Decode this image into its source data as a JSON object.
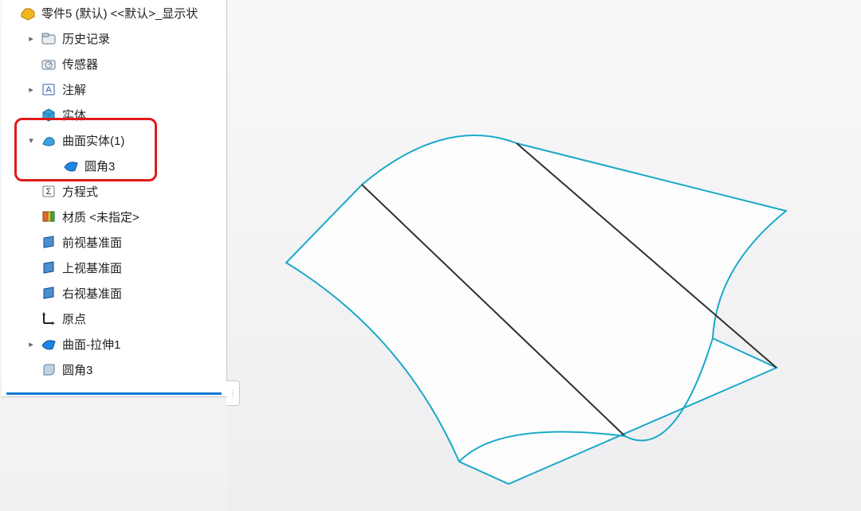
{
  "tree": {
    "root": "零件5 (默认) <<默认>_显示状",
    "history": "历史记录",
    "sensors": "传感器",
    "annotations": "注解",
    "solid_bodies": "实体",
    "surface_bodies": "曲面实体(1)",
    "fillet3_child": "圆角3",
    "equations": "方程式",
    "material": "材质 <未指定>",
    "front_plane": "前视基准面",
    "top_plane": "上视基准面",
    "right_plane": "右视基准面",
    "origin": "原点",
    "surface_extrude": "曲面-拉伸1",
    "fillet3": "圆角3"
  },
  "colors": {
    "surface_edge": "#1aa9c8",
    "body_line": "#303030",
    "highlight": "#e11a1a"
  }
}
